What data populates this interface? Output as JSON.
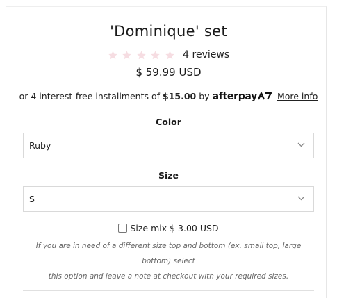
{
  "product": {
    "title": "'Dominique' set",
    "rating_stars": 0,
    "rating_max": 5,
    "star_color": "#f6dde2",
    "review_count": "4 reviews",
    "price": "$ 59.99 USD"
  },
  "afterpay": {
    "prefix": "or 4 interest-free installments of",
    "amount": "$15.00",
    "by": "by",
    "logo_text": "afterpay",
    "more_info": "More info"
  },
  "options": {
    "color": {
      "label": "Color",
      "selected": "Ruby"
    },
    "size": {
      "label": "Size",
      "selected": "S"
    }
  },
  "size_mix": {
    "checked": false,
    "label": "Size mix $ 3.00 USD",
    "note_line1": "If you are in need of a different size top and bottom (ex. small top, large bottom) select",
    "note_line2": "this option and leave a note at checkout with your required sizes."
  }
}
